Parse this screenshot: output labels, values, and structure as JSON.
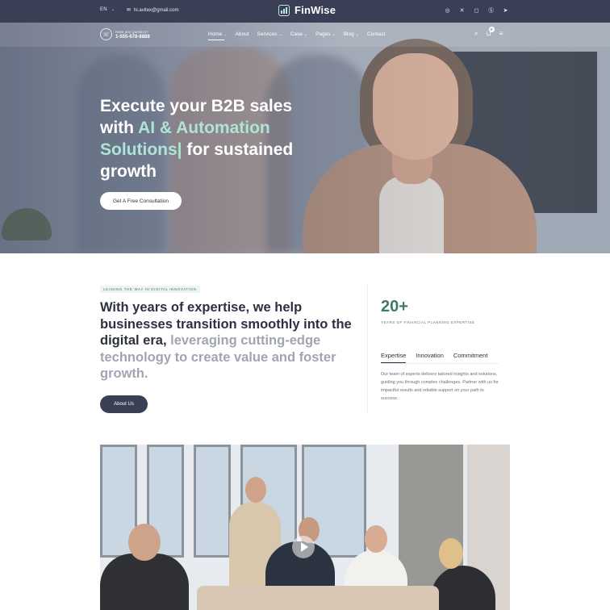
{
  "topbar": {
    "language": "EN",
    "email": "hi.avitex@gmail.com",
    "brand_name": "FinWise"
  },
  "nav": {
    "question_label": "Have any Question?",
    "phone": "1-555-678-8888",
    "menu": [
      {
        "label": "Home",
        "dropdown": true
      },
      {
        "label": "About",
        "dropdown": false
      },
      {
        "label": "Services",
        "dropdown": true
      },
      {
        "label": "Case",
        "dropdown": true
      },
      {
        "label": "Pages",
        "dropdown": true
      },
      {
        "label": "Blog",
        "dropdown": true
      },
      {
        "label": "Contact",
        "dropdown": false
      }
    ],
    "cart_count": "0"
  },
  "hero": {
    "title_part1": "Execute your B2B sales with ",
    "title_accent": "AI & Automation Solutions|",
    "title_part2": " for sustained growth",
    "cta": "Get A Free Consultation"
  },
  "about": {
    "tagline": "LEADING THE WAY IN DIGITAL INNOVATION",
    "heading_dark": "With years of expertise, we help businesses transition smoothly into the digital era, ",
    "heading_muted": "leveraging cutting-edge technology to create value and foster growth.",
    "button": "About Us"
  },
  "stats": {
    "number": "20+",
    "label": "YEARS OF FINANCIAL PLANNING EXPERTISE"
  },
  "tabs": {
    "items": [
      "Expertise",
      "Innovation",
      "Commitment"
    ],
    "active": "Expertise",
    "text": "Our team of experts delivers tailored insights and solutions, guiding you through complex challenges. Partner with us for impactful results and reliable support on your path to success."
  },
  "colors": {
    "topbar": "#3a3f56",
    "accent_green": "#3e7a66",
    "hero_accent": "#aee4d6",
    "muted_text": "#a1a5b1"
  },
  "icons": [
    "chevron-down-icon",
    "mail-icon",
    "chart-logo-icon",
    "whatsapp-icon",
    "x-icon",
    "instagram-icon",
    "skype-icon",
    "telegram-icon",
    "phone-icon",
    "search-icon",
    "cart-icon",
    "menu-icon",
    "play-icon"
  ]
}
